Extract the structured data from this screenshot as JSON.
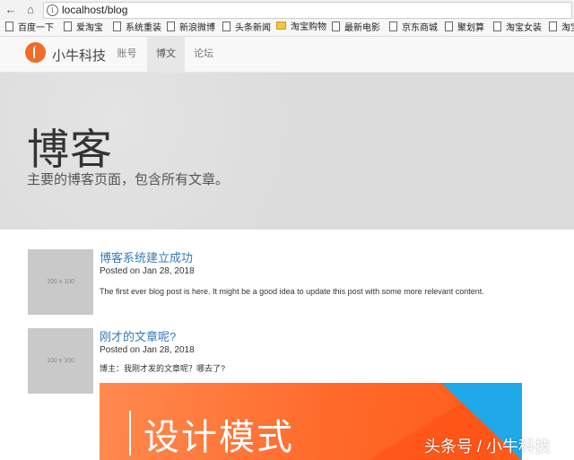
{
  "browser": {
    "url": "localhost/blog",
    "bookmarks": [
      "百度一下",
      "爱淘宝",
      "系统重装",
      "新浪微博",
      "头条新闻",
      "淘宝购物",
      "最新电影",
      "京东商城",
      "聚划算",
      "淘宝女装",
      "淘宝"
    ]
  },
  "site": {
    "brand": "小牛科技",
    "nav": [
      "账号",
      "博文",
      "论坛"
    ],
    "active_nav": "博文"
  },
  "hero": {
    "title": "博客",
    "subtitle": "主要的博客页面，包含所有文章。"
  },
  "posts": [
    {
      "thumb": "100 x 100",
      "title": "博客系统建立成功",
      "meta": "Posted on Jan 28, 2018",
      "body": "The first ever blog post is here. It might be a good idea to update this post with some more relevant content."
    },
    {
      "thumb": "100 x 100",
      "title": "刚才的文章呢?",
      "meta": "Posted on Jan 28, 2018",
      "body": "博主：我刚才发的文章呢？哪去了?"
    }
  ],
  "banner": {
    "text": "设计模式"
  },
  "watermark": "头条号 / 小牛科技",
  "colors": {
    "accent": "#337ab7",
    "logo": "#f26b28",
    "banner_orange": "#ff6a2a",
    "banner_blue": "#1fa9e8"
  }
}
